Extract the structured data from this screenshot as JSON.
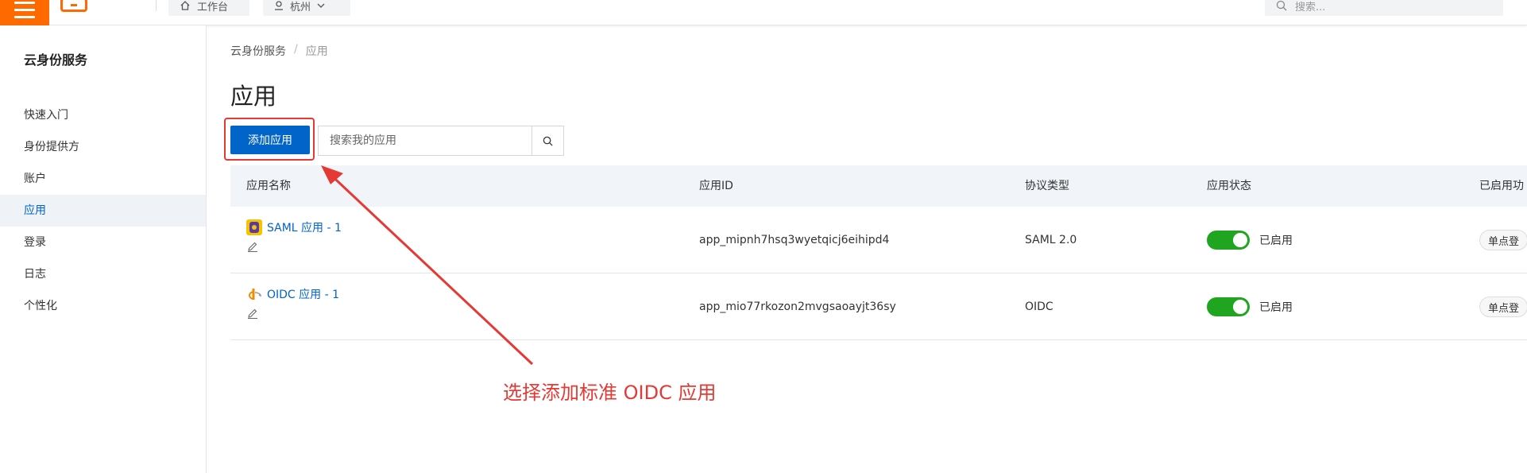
{
  "topbar": {
    "workbench_label": "工作台",
    "region_label": "杭州",
    "search_placeholder": "搜索..."
  },
  "sidebar": {
    "title": "云身份服务",
    "items": [
      {
        "label": "快速入门"
      },
      {
        "label": "身份提供方"
      },
      {
        "label": "账户"
      },
      {
        "label": "应用",
        "active": true
      },
      {
        "label": "登录"
      },
      {
        "label": "日志"
      },
      {
        "label": "个性化"
      }
    ]
  },
  "breadcrumb": [
    "云身份服务",
    "/",
    "应用"
  ],
  "page": {
    "title": "应用",
    "add_button": "添加应用",
    "search_placeholder": "搜索我的应用"
  },
  "table": {
    "headers": [
      "应用名称",
      "应用ID",
      "协议类型",
      "应用状态",
      "已启用功"
    ],
    "rows": [
      {
        "name": "SAML 应用 - 1",
        "id": "app_mipnh7hsq3wyetqicj6eihipd4",
        "protocol": "SAML 2.0",
        "status": "已启用",
        "feature": "单点登"
      },
      {
        "name": "OIDC 应用 - 1",
        "id": "app_mio77rkozon2mvgsaoayjt36sy",
        "protocol": "OIDC",
        "status": "已启用",
        "feature": "单点登"
      }
    ]
  },
  "annotation": {
    "text": "选择添加标准 OIDC 应用",
    "color": "#e53935"
  },
  "colors": {
    "brand": "#ff6a00",
    "primary": "#0064c8",
    "toggle_on": "#1fa51f"
  }
}
